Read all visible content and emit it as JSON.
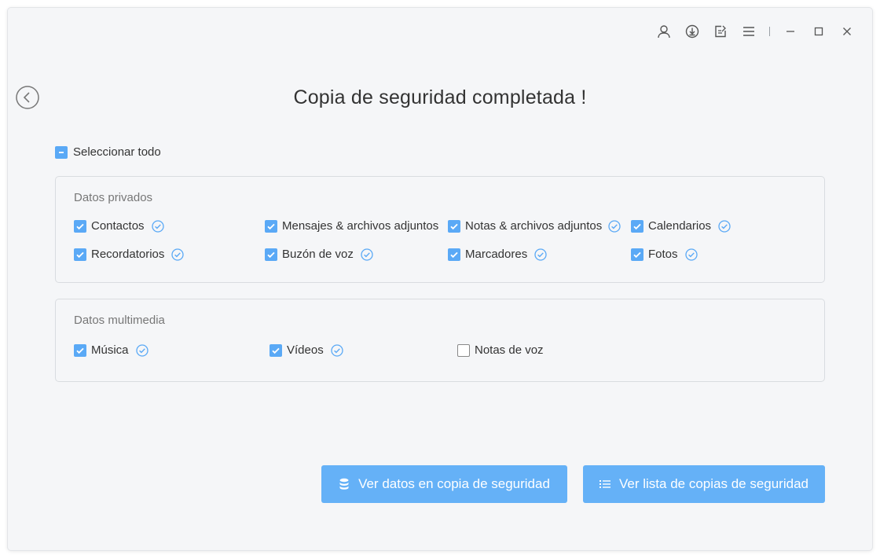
{
  "window": {
    "controls": {
      "account_icon": "user-icon",
      "download_icon": "download-icon",
      "feedback_icon": "feedback-icon",
      "menu_icon": "menu-icon",
      "minimize_icon": "minimize-icon",
      "maximize_icon": "maximize-icon",
      "close_icon": "close-icon"
    }
  },
  "header": {
    "back_icon": "back-arrow-icon",
    "title": "Copia de seguridad completada !"
  },
  "select_all": {
    "label": "Seleccionar todo",
    "state": "partial"
  },
  "private_data": {
    "title": "Datos privados",
    "items": [
      {
        "label": "Contactos",
        "checked": true,
        "completed": true
      },
      {
        "label": "Mensajes & archivos adjuntos",
        "checked": true,
        "completed": false
      },
      {
        "label": "Notas & archivos adjuntos",
        "checked": true,
        "completed": true
      },
      {
        "label": "Calendarios",
        "checked": true,
        "completed": true
      },
      {
        "label": "Recordatorios",
        "checked": true,
        "completed": true
      },
      {
        "label": "Buzón de voz",
        "checked": true,
        "completed": true
      },
      {
        "label": "Marcadores",
        "checked": true,
        "completed": true
      },
      {
        "label": "Fotos",
        "checked": true,
        "completed": true
      }
    ]
  },
  "media_data": {
    "title": "Datos multimedia",
    "items": [
      {
        "label": "Música",
        "checked": true,
        "completed": true
      },
      {
        "label": "Vídeos",
        "checked": true,
        "completed": true
      },
      {
        "label": "Notas de voz",
        "checked": false,
        "completed": false
      }
    ]
  },
  "actions": {
    "view_data_label": "Ver datos en copia de seguridad",
    "view_data_icon": "database-icon",
    "view_list_label": "Ver lista de copias de seguridad",
    "view_list_icon": "list-icon"
  },
  "colors": {
    "accent": "#5aa9f6",
    "button": "#65b1f7",
    "check_done": "#5aa9f6",
    "background": "#f5f6f8"
  }
}
